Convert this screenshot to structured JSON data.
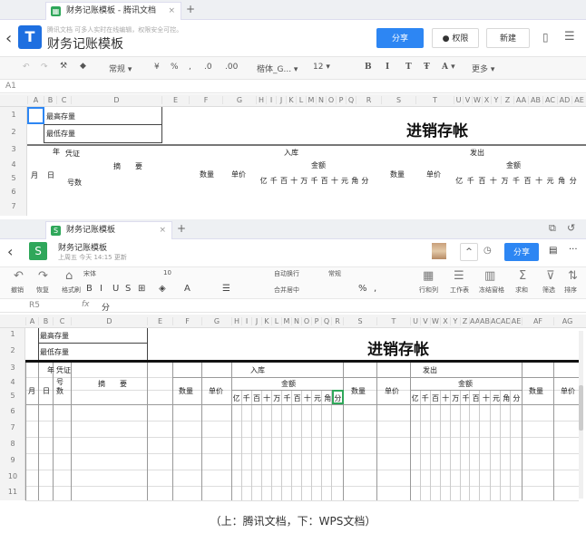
{
  "tencent": {
    "tab_title": "财务记账模板 - 腾讯文档",
    "subtitle": "腾讯文档  可多人实时在线编辑，权限安全可控。",
    "doc_title": "财务记账模板",
    "share": "分享",
    "permission": "权限",
    "new": "新建",
    "toolbar": [
      "常规 ▾",
      "¥",
      "%",
      ",",
      ".0",
      ".00",
      "楷体_G... ▾",
      "12 ▾",
      "B",
      "I",
      "T",
      "Ŧ",
      "A ▾",
      "更多 ▾"
    ],
    "cell_ref": "A1",
    "columns": [
      "A",
      "B",
      "C",
      "D",
      "E",
      "F",
      "G",
      "H",
      "I",
      "J",
      "K",
      "L",
      "M",
      "N",
      "O",
      "P",
      "Q",
      "R",
      "S",
      "T",
      "U",
      "V",
      "W",
      "X",
      "Y",
      "Z",
      "AA",
      "AB",
      "AC",
      "AD",
      "AE"
    ],
    "rows": [
      "1",
      "2",
      "3",
      "4",
      "5",
      "6",
      "7"
    ],
    "cells": {
      "max_stock": "最高存量",
      "min_stock": "最低存量",
      "title": "进销存帐",
      "year": "年",
      "voucher": "凭证",
      "month": "月",
      "day": "日",
      "number": "号数",
      "summary": "摘　　要",
      "in": "入库",
      "out": "发出",
      "amount": "金额",
      "qty": "数量",
      "price": "单价",
      "digits": "亿千百十万千百十元角分"
    }
  },
  "wps": {
    "tab_title": "财务记账模板",
    "doc_title": "财务记账模板",
    "subtitle": "上周五 今天 14:15 更新",
    "share": "分享",
    "toolbar": {
      "undo": "撤销",
      "redo": "恢复",
      "format_painter": "格式刷",
      "font": "宋体",
      "size": "10",
      "wrap": "自动换行",
      "merge": "合并居中",
      "number_format": "常规",
      "row_col": "行和列",
      "sheet": "工作表",
      "freeze": "冻结窗格",
      "sum": "求和",
      "filter": "筛选",
      "sort": "排序"
    },
    "cell_ref": "R5",
    "formula": "分",
    "columns": [
      "A",
      "B",
      "C",
      "D",
      "E",
      "F",
      "G",
      "H",
      "I",
      "J",
      "K",
      "L",
      "M",
      "N",
      "O",
      "P",
      "Q",
      "R",
      "S",
      "T",
      "U",
      "V",
      "W",
      "X",
      "Y",
      "Z",
      "AA",
      "AB",
      "AC",
      "AD",
      "AE",
      "AF",
      "AG"
    ],
    "rows": [
      "1",
      "2",
      "3",
      "4",
      "5",
      "6",
      "7",
      "8",
      "9",
      "10",
      "11"
    ],
    "cells": {
      "max_stock": "最高存量",
      "min_stock": "最低存量",
      "title": "进销存帐",
      "year": "年",
      "voucher": "凭证",
      "month": "月",
      "day": "日",
      "number": "号数",
      "summary": "摘　　要",
      "in": "入库",
      "out": "发出",
      "amount": "金额",
      "qty": "数量",
      "price": "单价",
      "digits": "亿千百十万千百十元角分"
    }
  },
  "caption": "（上：腾讯文档，下：WPS文档）"
}
